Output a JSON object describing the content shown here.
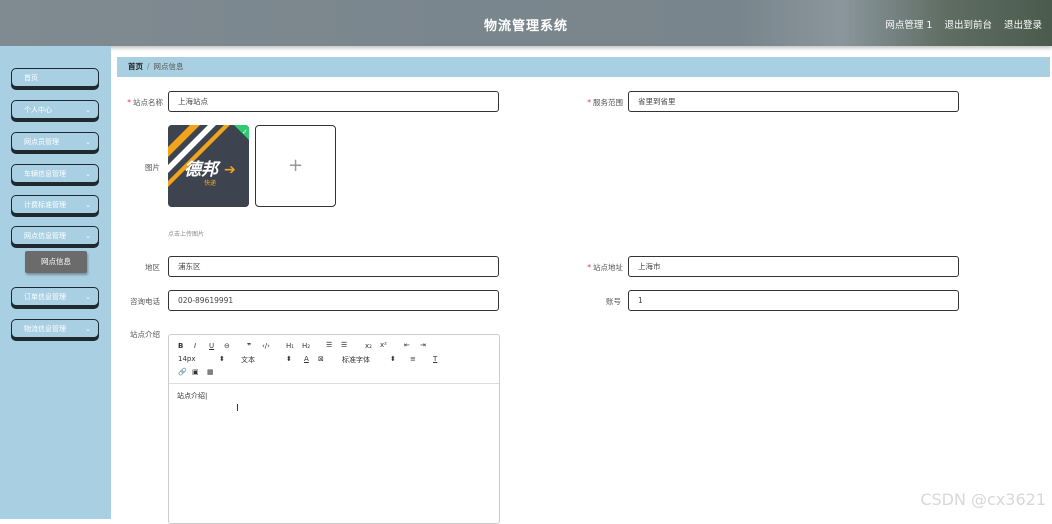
{
  "header": {
    "title": "物流管理系统",
    "user": "网点管理 1",
    "to_frontend": "退出到前台",
    "logout": "退出登录"
  },
  "sidebar": {
    "items": [
      {
        "label": "首页"
      },
      {
        "label": "个人中心"
      },
      {
        "label": "网点员管理"
      },
      {
        "label": "车辆信息管理"
      },
      {
        "label": "计费标准管理"
      },
      {
        "label": "网点信息管理"
      },
      {
        "label": "订单信息管理"
      },
      {
        "label": "物流信息管理"
      }
    ],
    "sub_active": "网点信息"
  },
  "breadcrumb": {
    "home": "首页",
    "current": "网点信息"
  },
  "form": {
    "station_name": {
      "label": "站点名称",
      "value": "上海站点"
    },
    "service_range": {
      "label": "服务范围",
      "value": "省里到省里"
    },
    "image": {
      "label": "图片",
      "hint": "点击上传图片",
      "logo_text": "德邦",
      "logo_sub": "快递"
    },
    "region": {
      "label": "地区",
      "value": "浦东区"
    },
    "address": {
      "label": "站点地址",
      "value": "上海市"
    },
    "phone": {
      "label": "咨询电话",
      "value": "020-89619991"
    },
    "account": {
      "label": "账号",
      "value": "1"
    },
    "intro": {
      "label": "站点介绍",
      "value": "站点介绍"
    }
  },
  "editor": {
    "font_size": "14px",
    "text_style": "文本",
    "font_family": "标准字体"
  },
  "watermark": "CSDN @cx3621"
}
